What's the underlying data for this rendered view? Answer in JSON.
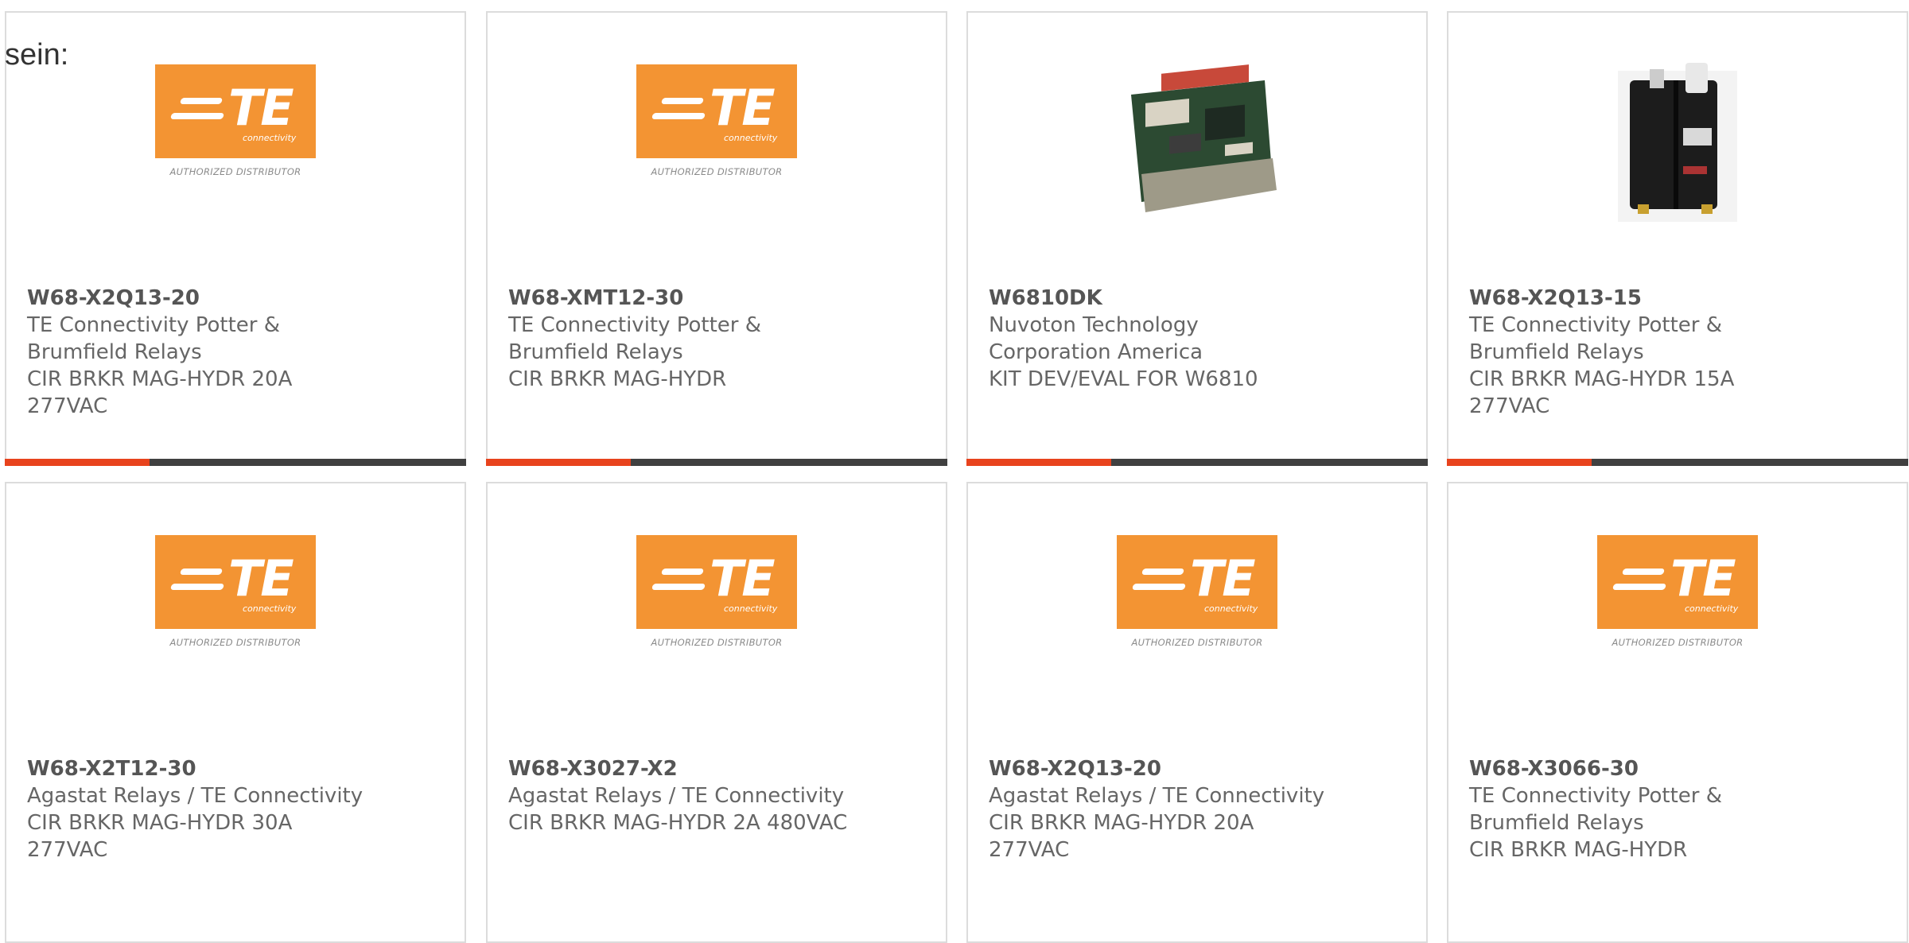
{
  "heading": "sein:",
  "logo": {
    "brand": "TE",
    "sub": "connectivity",
    "tagline": "AUTHORIZED DISTRIBUTOR",
    "color": "#f39433"
  },
  "colors": {
    "accent": "#e8431d",
    "track": "#404040"
  },
  "cards": [
    {
      "part": "W68-X2Q13-20",
      "manufacturer": "TE Connectivity Potter & Brumfield Relays",
      "description": "CIR BRKR MAG-HYDR 20A 277VAC",
      "image": "te-logo"
    },
    {
      "part": "W68-XMT12-30",
      "manufacturer": "TE Connectivity Potter & Brumfield Relays",
      "description": "CIR BRKR MAG-HYDR",
      "image": "te-logo"
    },
    {
      "part": "W6810DK",
      "manufacturer": "Nuvoton Technology Corporation America",
      "description": "KIT DEV/EVAL FOR W6810",
      "image": "circuit-board-photo"
    },
    {
      "part": "W68-X2Q13-15",
      "manufacturer": "TE Connectivity Potter & Brumfield Relays",
      "description": "CIR BRKR MAG-HYDR 15A 277VAC",
      "image": "circuit-breaker-photo"
    },
    {
      "part": "W68-X2T12-30",
      "manufacturer": "Agastat Relays / TE Connectivity",
      "description": "CIR BRKR MAG-HYDR 30A 277VAC",
      "image": "te-logo"
    },
    {
      "part": "W68-X3027-X2",
      "manufacturer": "Agastat Relays / TE Connectivity",
      "description": "CIR BRKR MAG-HYDR 2A 480VAC",
      "image": "te-logo"
    },
    {
      "part": "W68-X2Q13-20",
      "manufacturer": "Agastat Relays / TE Connectivity",
      "description": "CIR BRKR MAG-HYDR 20A 277VAC",
      "image": "te-logo"
    },
    {
      "part": "W68-X3066-30",
      "manufacturer": "TE Connectivity Potter & Brumfield Relays",
      "description": "CIR BRKR MAG-HYDR",
      "image": "te-logo"
    }
  ]
}
